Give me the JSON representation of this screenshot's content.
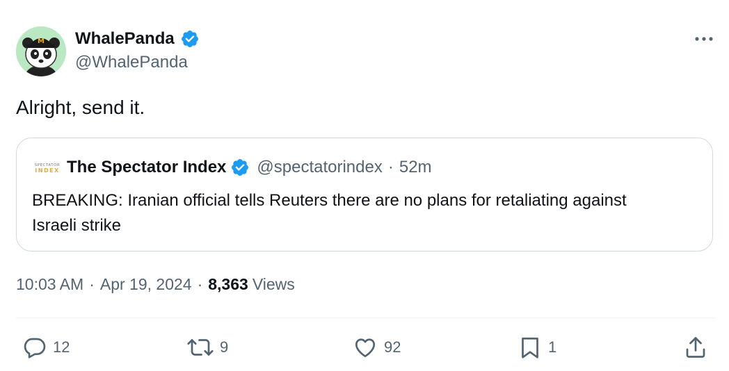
{
  "author": {
    "display_name": "WhalePanda",
    "handle": "@WhalePanda",
    "verified": true
  },
  "tweet": {
    "text": "Alright, send it."
  },
  "quoted_tweet": {
    "display_name": "The Spectator Index",
    "handle": "@spectatorindex",
    "separator": "·",
    "time_ago": "52m",
    "verified": true,
    "text": "BREAKING: Iranian official tells Reuters there are no plans for retaliating against Israeli strike"
  },
  "meta": {
    "time": "10:03 AM",
    "date": "Apr 19, 2024",
    "separator": "·",
    "views_count": "8,363",
    "views_label": "Views"
  },
  "actions": {
    "replies": "12",
    "reposts": "9",
    "likes": "92",
    "bookmarks": "1"
  },
  "colors": {
    "verified_blue": "#1d9bf0",
    "secondary_text": "#536471",
    "border": "#cfd9de"
  }
}
